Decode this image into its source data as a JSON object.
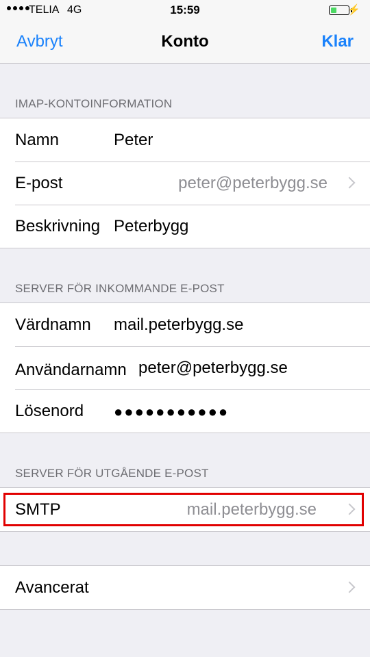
{
  "status": {
    "carrier": "TELIA",
    "network": "4G",
    "time": "15:59",
    "battery_level": 0.35,
    "accent": "#4cd964"
  },
  "nav": {
    "cancel": "Avbryt",
    "title": "Konto",
    "done": "Klar",
    "accent": "#1a82fb"
  },
  "imap": {
    "header": "IMAP-KONTOINFORMATION",
    "rows": [
      {
        "label": "Namn",
        "value": "Peter"
      },
      {
        "label": "E-post",
        "value": "peter@peterbygg.se"
      },
      {
        "label": "Beskrivning",
        "value": "Peterbygg"
      }
    ]
  },
  "incoming": {
    "header": "SERVER FÖR INKOMMANDE E-POST",
    "rows": [
      {
        "label": "Värdnamn",
        "value": "mail.peterbygg.se"
      },
      {
        "label": "Användarnamn",
        "value": "peter@peterbygg.se"
      },
      {
        "label": "Lösenord",
        "value": "●●●●●●●●●●●"
      }
    ]
  },
  "outgoing": {
    "header": "SERVER FÖR UTGÅENDE E-POST",
    "rows": [
      {
        "label": "SMTP",
        "value": "mail.peterbygg.se"
      }
    ],
    "highlight_color": "#e10000"
  },
  "advanced": {
    "label": "Avancerat"
  }
}
